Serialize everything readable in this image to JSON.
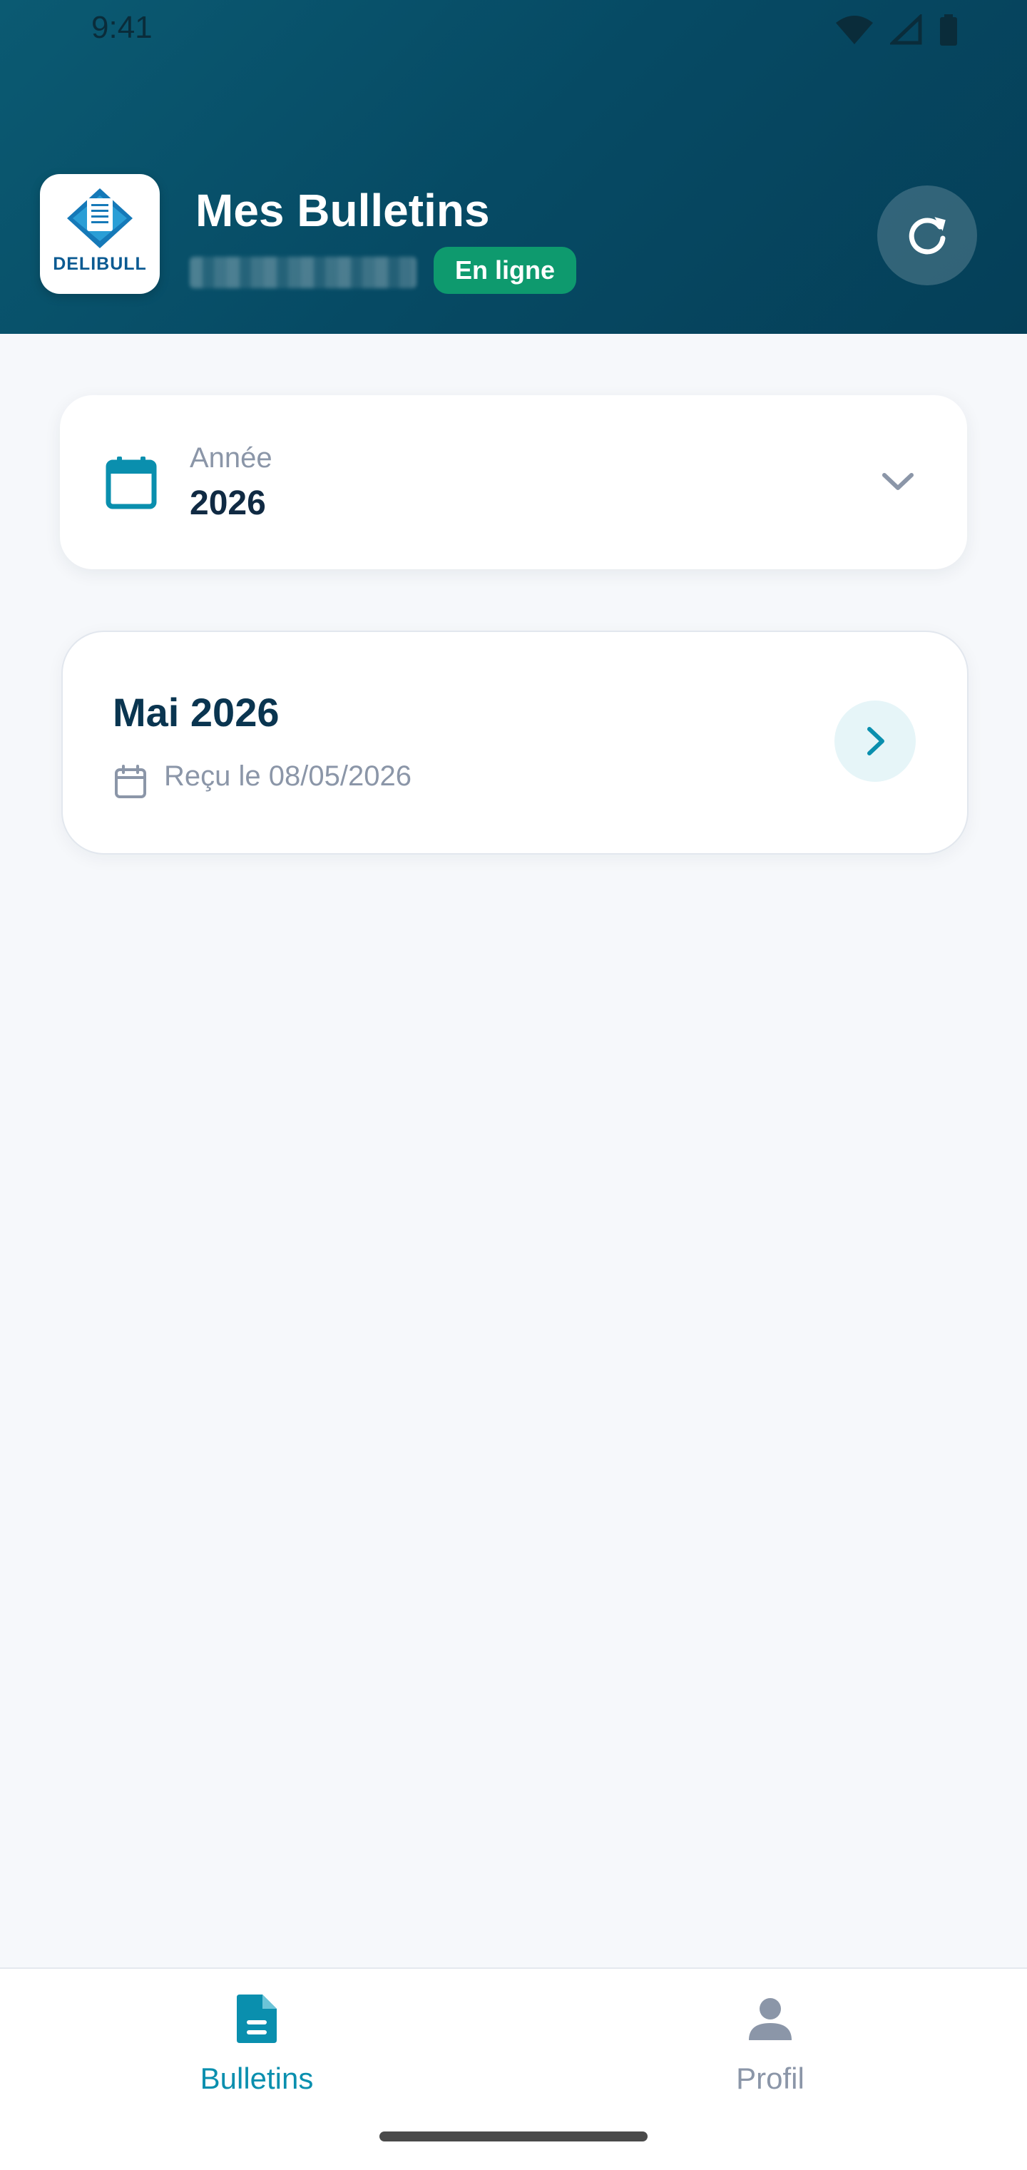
{
  "status_bar": {
    "time": "9:41"
  },
  "header": {
    "logo_text": "DELIBULL",
    "title": "Mes Bulletins",
    "status_badge": "En ligne"
  },
  "year_selector": {
    "label": "Année",
    "value": "2026"
  },
  "bulletins": [
    {
      "title": "Mai 2026",
      "received": "Reçu le 08/05/2026"
    }
  ],
  "bottom_nav": {
    "items": [
      {
        "label": "Bulletins",
        "active": true
      },
      {
        "label": "Profil",
        "active": false
      }
    ]
  },
  "colors": {
    "header": "#064a64",
    "accent": "#0a8fae",
    "online": "#0e9a6e",
    "inactive": "#8b96a8"
  },
  "icons": {
    "refresh": "refresh-icon",
    "calendar": "calendar-icon",
    "dropdown": "chevron-down-icon",
    "open": "chevron-right-icon",
    "bulletins_tab": "document-icon",
    "profile_tab": "user-icon"
  }
}
